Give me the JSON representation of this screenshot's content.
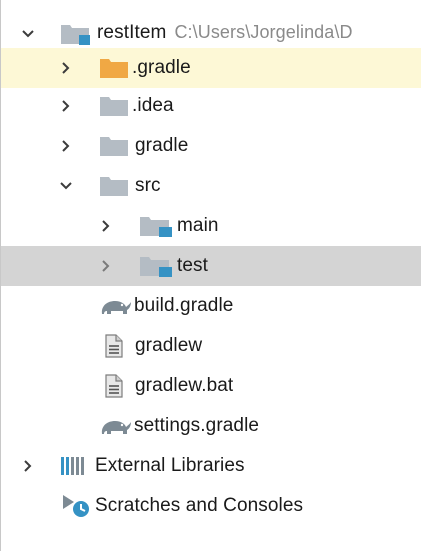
{
  "tree": {
    "root": {
      "label": "restItem",
      "path": "C:\\Users\\Jorgelinda\\D"
    },
    "items": [
      {
        "label": ".gradle"
      },
      {
        "label": ".idea"
      },
      {
        "label": "gradle"
      },
      {
        "label": "src"
      },
      {
        "label": "main"
      },
      {
        "label": "test"
      },
      {
        "label": "build.gradle"
      },
      {
        "label": "gradlew"
      },
      {
        "label": "gradlew.bat"
      },
      {
        "label": "settings.gradle"
      },
      {
        "label": "External Libraries"
      },
      {
        "label": "Scratches and Consoles"
      }
    ]
  },
  "colors": {
    "folder_grey": "#b4bcc4",
    "folder_orange": "#f0a844",
    "module_blue": "#3592c4",
    "highlight_yellow": "#fdf8d6",
    "selection_grey": "#d4d4d4",
    "arrow": "#3c3c3c"
  }
}
